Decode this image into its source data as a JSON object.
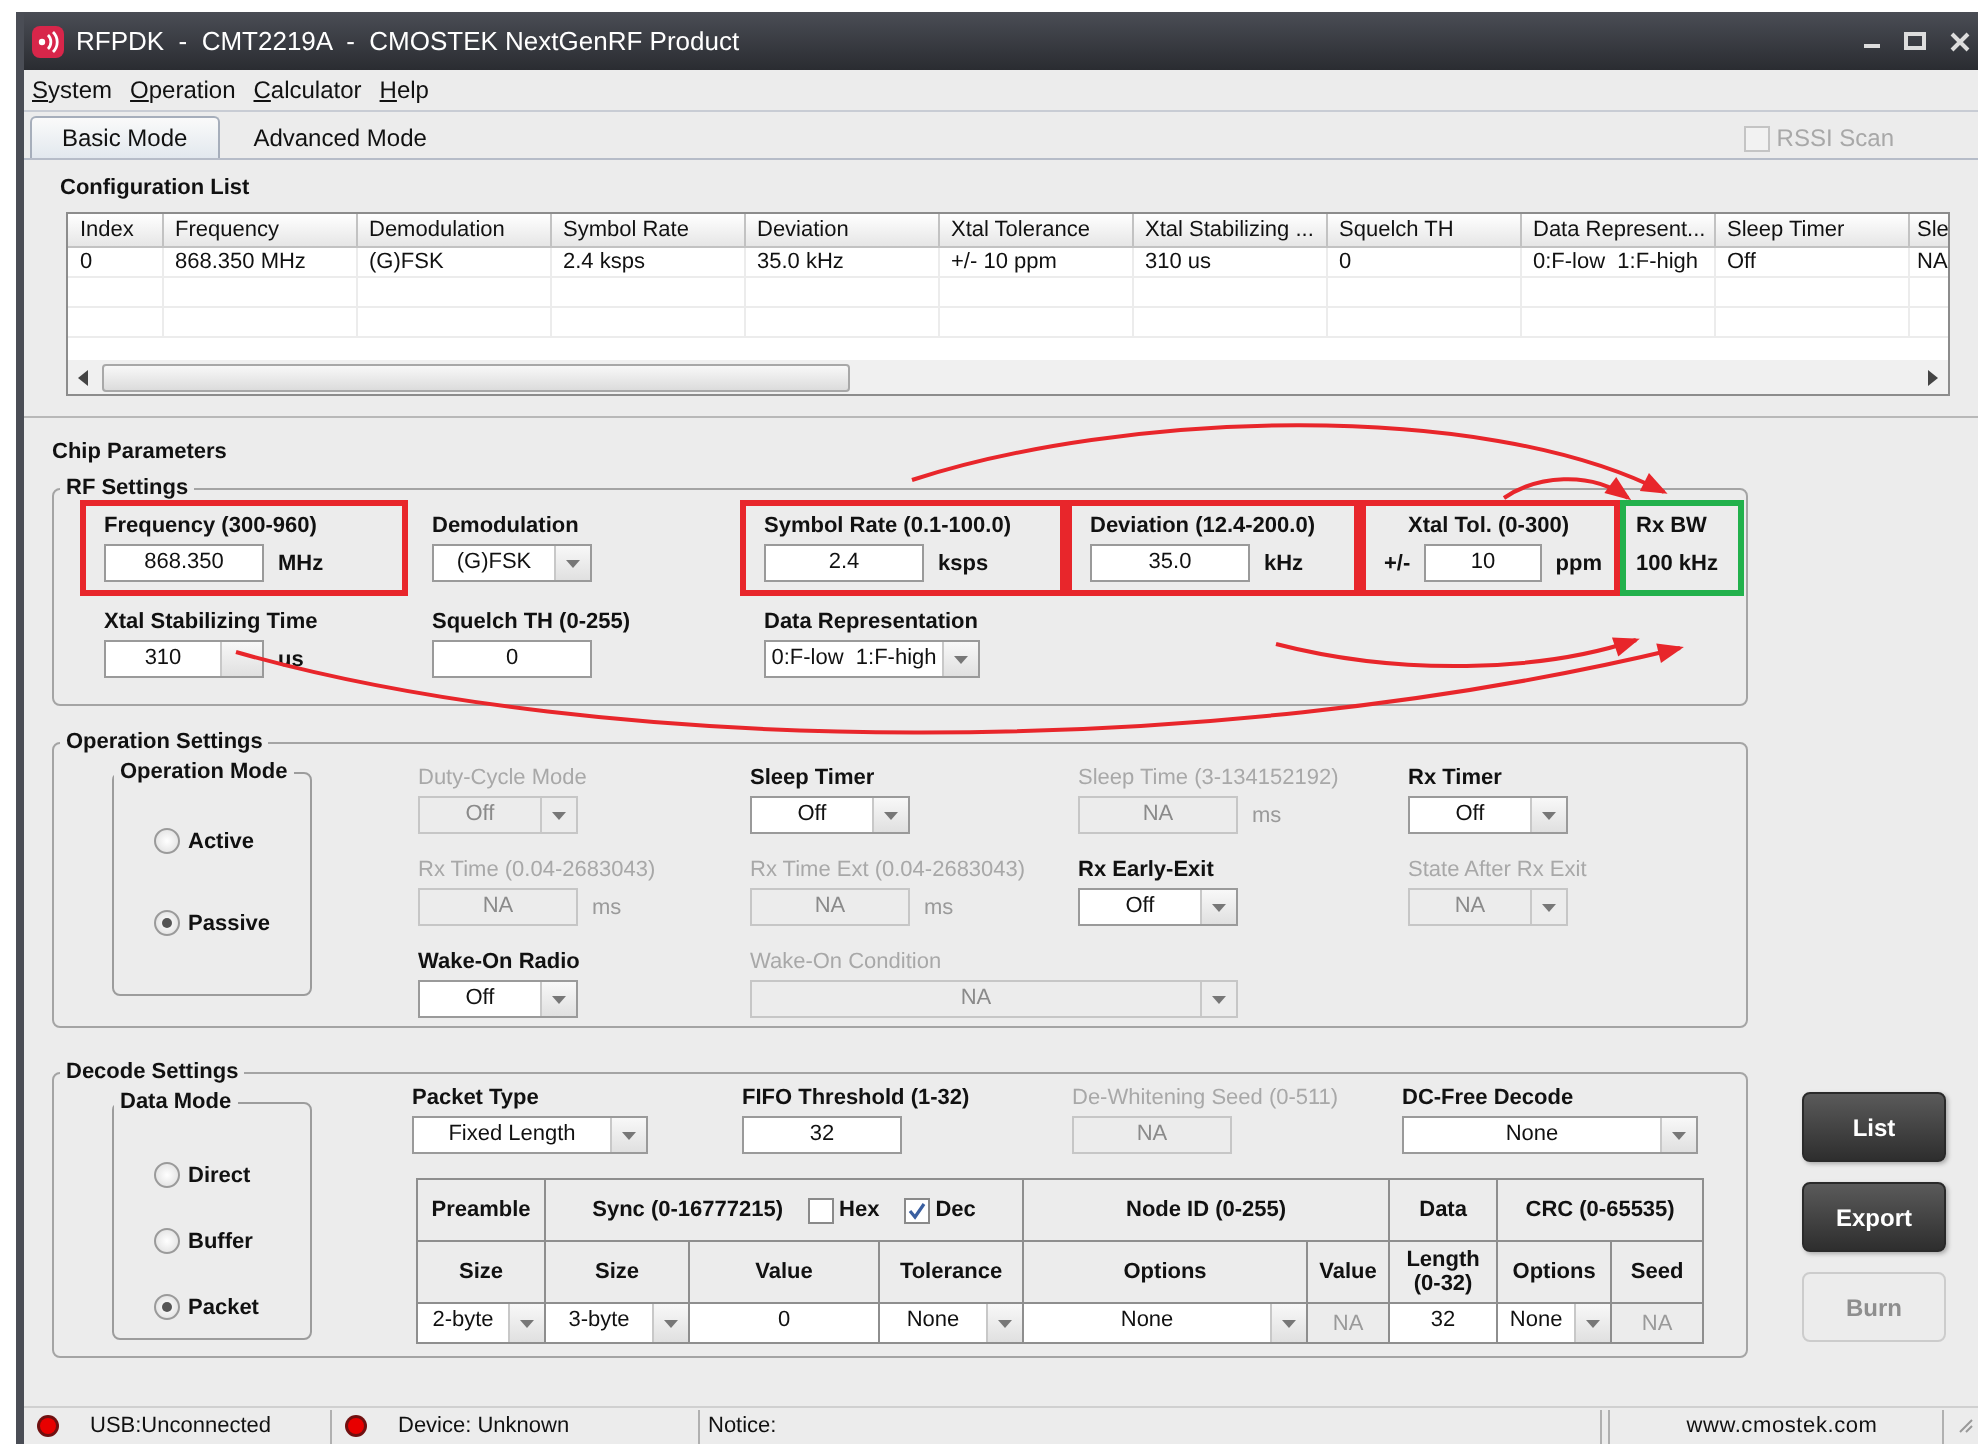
{
  "window": {
    "title": "RFPDK  -  CMT2219A  -  CMOSTEK NextGenRF Product"
  },
  "menu": [
    "System",
    "Operation",
    "Calculator",
    "Help"
  ],
  "tabs": [
    {
      "label": "Basic Mode",
      "selected": true
    },
    {
      "label": "Advanced Mode",
      "selected": false
    }
  ],
  "rssi_scan": {
    "label": "RSSI Scan",
    "checked": false,
    "disabled": true
  },
  "configuration_list": {
    "title": "Configuration List",
    "columns": [
      "Index",
      "Frequency",
      "Demodulation",
      "Symbol Rate",
      "Deviation",
      "Xtal Tolerance",
      "Xtal Stabilizing ...",
      "Squelch TH",
      "Data Represent...",
      "Sleep Timer",
      "Sle"
    ],
    "rows": [
      [
        "0",
        "868.350 MHz",
        "(G)FSK",
        "2.4 ksps",
        "35.0 kHz",
        "+/- 10 ppm",
        "310 us",
        "0",
        "0:F-low  1:F-high",
        "Off",
        "NA"
      ]
    ]
  },
  "chip_parameters": {
    "title": "Chip Parameters",
    "rf_settings": {
      "title": "RF Settings",
      "fields": [
        {
          "kind": "input",
          "label": "Frequency (300-960)",
          "value": "868.350",
          "unit": "MHz",
          "disabled": false,
          "color": "#e8262b"
        },
        {
          "kind": "dropdown",
          "label": "Demodulation",
          "value": "(G)FSK",
          "disabled": false
        },
        {
          "kind": "input",
          "label": "Symbol Rate (0.1-100.0)",
          "value": "2.4",
          "unit": "ksps",
          "disabled": false,
          "color": "#e8262b"
        },
        {
          "kind": "input",
          "label": "Deviation (12.4-200.0)",
          "value": "35.0",
          "unit": "kHz",
          "disabled": false,
          "color": "#e8262b"
        },
        {
          "kind": "input",
          "label": "Xtal Tol. (0-300)",
          "prefix": "+/-",
          "value": "10",
          "unit": "ppm",
          "disabled": false,
          "color": "#e8262b"
        },
        {
          "kind": "readout",
          "label": "Rx BW",
          "value": "100 kHz",
          "color": "#22b14c"
        },
        {
          "kind": "combo",
          "label": "Xtal Stabilizing Time",
          "value": "310",
          "unit": "us",
          "disabled": false
        },
        {
          "kind": "input",
          "label": "Squelch TH (0-255)",
          "value": "0",
          "disabled": false
        },
        {
          "kind": "dropdown",
          "label": "Data Representation",
          "value": "0:F-low  1:F-high",
          "disabled": false
        }
      ]
    },
    "operation_settings": {
      "title": "Operation Settings",
      "operation_mode": {
        "title": "Operation Mode",
        "options": [
          {
            "label": "Active",
            "selected": false
          },
          {
            "label": "Passive",
            "selected": true
          }
        ]
      },
      "fields": [
        {
          "kind": "dropdown",
          "label": "Duty-Cycle Mode",
          "value": "Off",
          "disabled": true
        },
        {
          "kind": "dropdown",
          "label": "Sleep Timer",
          "value": "Off",
          "disabled": false
        },
        {
          "kind": "input",
          "label": "Sleep Time (3-134152192)",
          "value": "NA",
          "unit": "ms",
          "disabled": true
        },
        {
          "kind": "dropdown",
          "label": "Rx Timer",
          "value": "Off",
          "disabled": false
        },
        {
          "kind": "input",
          "label": "Rx Time (0.04-2683043)",
          "value": "NA",
          "unit": "ms",
          "disabled": true
        },
        {
          "kind": "input",
          "label": "Rx Time Ext (0.04-2683043)",
          "value": "NA",
          "unit": "ms",
          "disabled": true
        },
        {
          "kind": "dropdown",
          "label": "Rx Early-Exit",
          "value": "Off",
          "disabled": false
        },
        {
          "kind": "dropdown",
          "label": "State After Rx Exit",
          "value": "NA",
          "disabled": true
        },
        {
          "kind": "dropdown",
          "label": "Wake-On Radio",
          "value": "Off",
          "disabled": false
        },
        {
          "kind": "wide_dropdown",
          "label": "Wake-On Condition",
          "value": "NA",
          "disabled": true
        }
      ]
    },
    "decode_settings": {
      "title": "Decode Settings",
      "data_mode": {
        "title": "Data Mode",
        "options": [
          {
            "label": "Direct",
            "selected": false
          },
          {
            "label": "Buffer",
            "selected": false
          },
          {
            "label": "Packet",
            "selected": true
          }
        ]
      },
      "fields": [
        {
          "kind": "dropdown",
          "label": "Packet Type",
          "value": "Fixed Length",
          "disabled": false
        },
        {
          "kind": "input",
          "label": "FIFO Threshold (1-32)",
          "value": "32",
          "disabled": false
        },
        {
          "kind": "input",
          "label": "De-Whitening Seed (0-511)",
          "value": "NA",
          "disabled": true
        },
        {
          "kind": "wide_dropdown",
          "label": "DC-Free Decode",
          "value": "None",
          "disabled": false
        }
      ],
      "packet_table": {
        "groups": [
          {
            "label": "Preamble",
            "columns": [
              {
                "header": "Size",
                "cell": {
                  "kind": "dropdown",
                  "value": "2-byte",
                  "disabled": false
                }
              }
            ]
          },
          {
            "label": "Sync (0-16777215)",
            "checkboxes": [
              {
                "label": "Hex",
                "checked": false
              },
              {
                "label": "Dec",
                "checked": true
              }
            ],
            "columns": [
              {
                "header": "Size",
                "cell": {
                  "kind": "dropdown",
                  "value": "3-byte",
                  "disabled": false
                }
              },
              {
                "header": "Value",
                "cell": {
                  "kind": "input",
                  "value": "0",
                  "disabled": false
                }
              },
              {
                "header": "Tolerance",
                "cell": {
                  "kind": "dropdown",
                  "value": "None",
                  "disabled": false
                }
              }
            ]
          },
          {
            "label": "Node ID (0-255)",
            "columns": [
              {
                "header": "Options",
                "cell": {
                  "kind": "dropdown",
                  "value": "None",
                  "disabled": false
                }
              },
              {
                "header": "Value",
                "cell": {
                  "kind": "readout",
                  "value": "NA",
                  "disabled": true
                }
              }
            ]
          },
          {
            "label": "Data",
            "columns": [
              {
                "header": "Length (0-32)",
                "cell": {
                  "kind": "input",
                  "value": "32",
                  "disabled": false
                }
              }
            ]
          },
          {
            "label": "CRC (0-65535)",
            "columns": [
              {
                "header": "Options",
                "cell": {
                  "kind": "dropdown",
                  "value": "None",
                  "disabled": false
                }
              },
              {
                "header": "Seed",
                "cell": {
                  "kind": "readout",
                  "value": "NA",
                  "disabled": true
                }
              }
            ]
          }
        ]
      }
    }
  },
  "buttons": [
    {
      "label": "List",
      "disabled": false
    },
    {
      "label": "Export",
      "disabled": false
    },
    {
      "label": "Burn",
      "disabled": true
    }
  ],
  "status_bar": [
    {
      "kind": "led",
      "text": "USB:Unconnected",
      "color": "#e80000"
    },
    {
      "kind": "led",
      "text": "Device: Unknown",
      "color": "#e80000"
    },
    {
      "kind": "notice",
      "text": "Notice:"
    },
    {
      "kind": "website",
      "text": "www.cmostek.com"
    }
  ]
}
